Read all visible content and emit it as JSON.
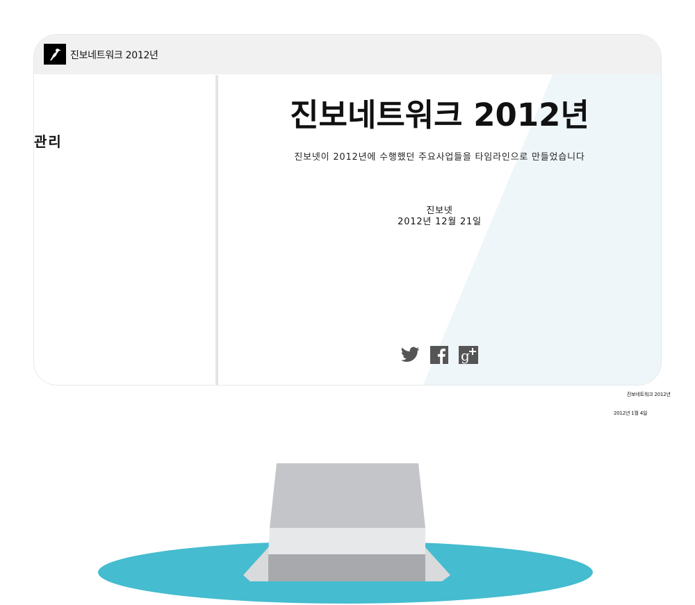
{
  "header": {
    "site_title": "진보네트워크 2012년"
  },
  "sidebar": {
    "label": "관리"
  },
  "main": {
    "title": "진보네트워크 2012년",
    "subtitle": "진보넷이 2012년에 수행했던 주요사업들을 타임라인으로 만들었습니다",
    "author": "진보넷",
    "date": "2012년 12월 21일"
  },
  "social": [
    {
      "name": "twitter-icon"
    },
    {
      "name": "facebook-icon"
    },
    {
      "name": "google-plus-icon"
    }
  ],
  "captions": {
    "title": "진보네트워크 2012년",
    "date": "2012년 1월 4일"
  },
  "colors": {
    "topbar": "#f1f1f1",
    "screen_tint": "#eef6f9",
    "base_teal": "#45bccf",
    "stand_gray": "#c4c5c8",
    "icon_gray": "#555555"
  }
}
